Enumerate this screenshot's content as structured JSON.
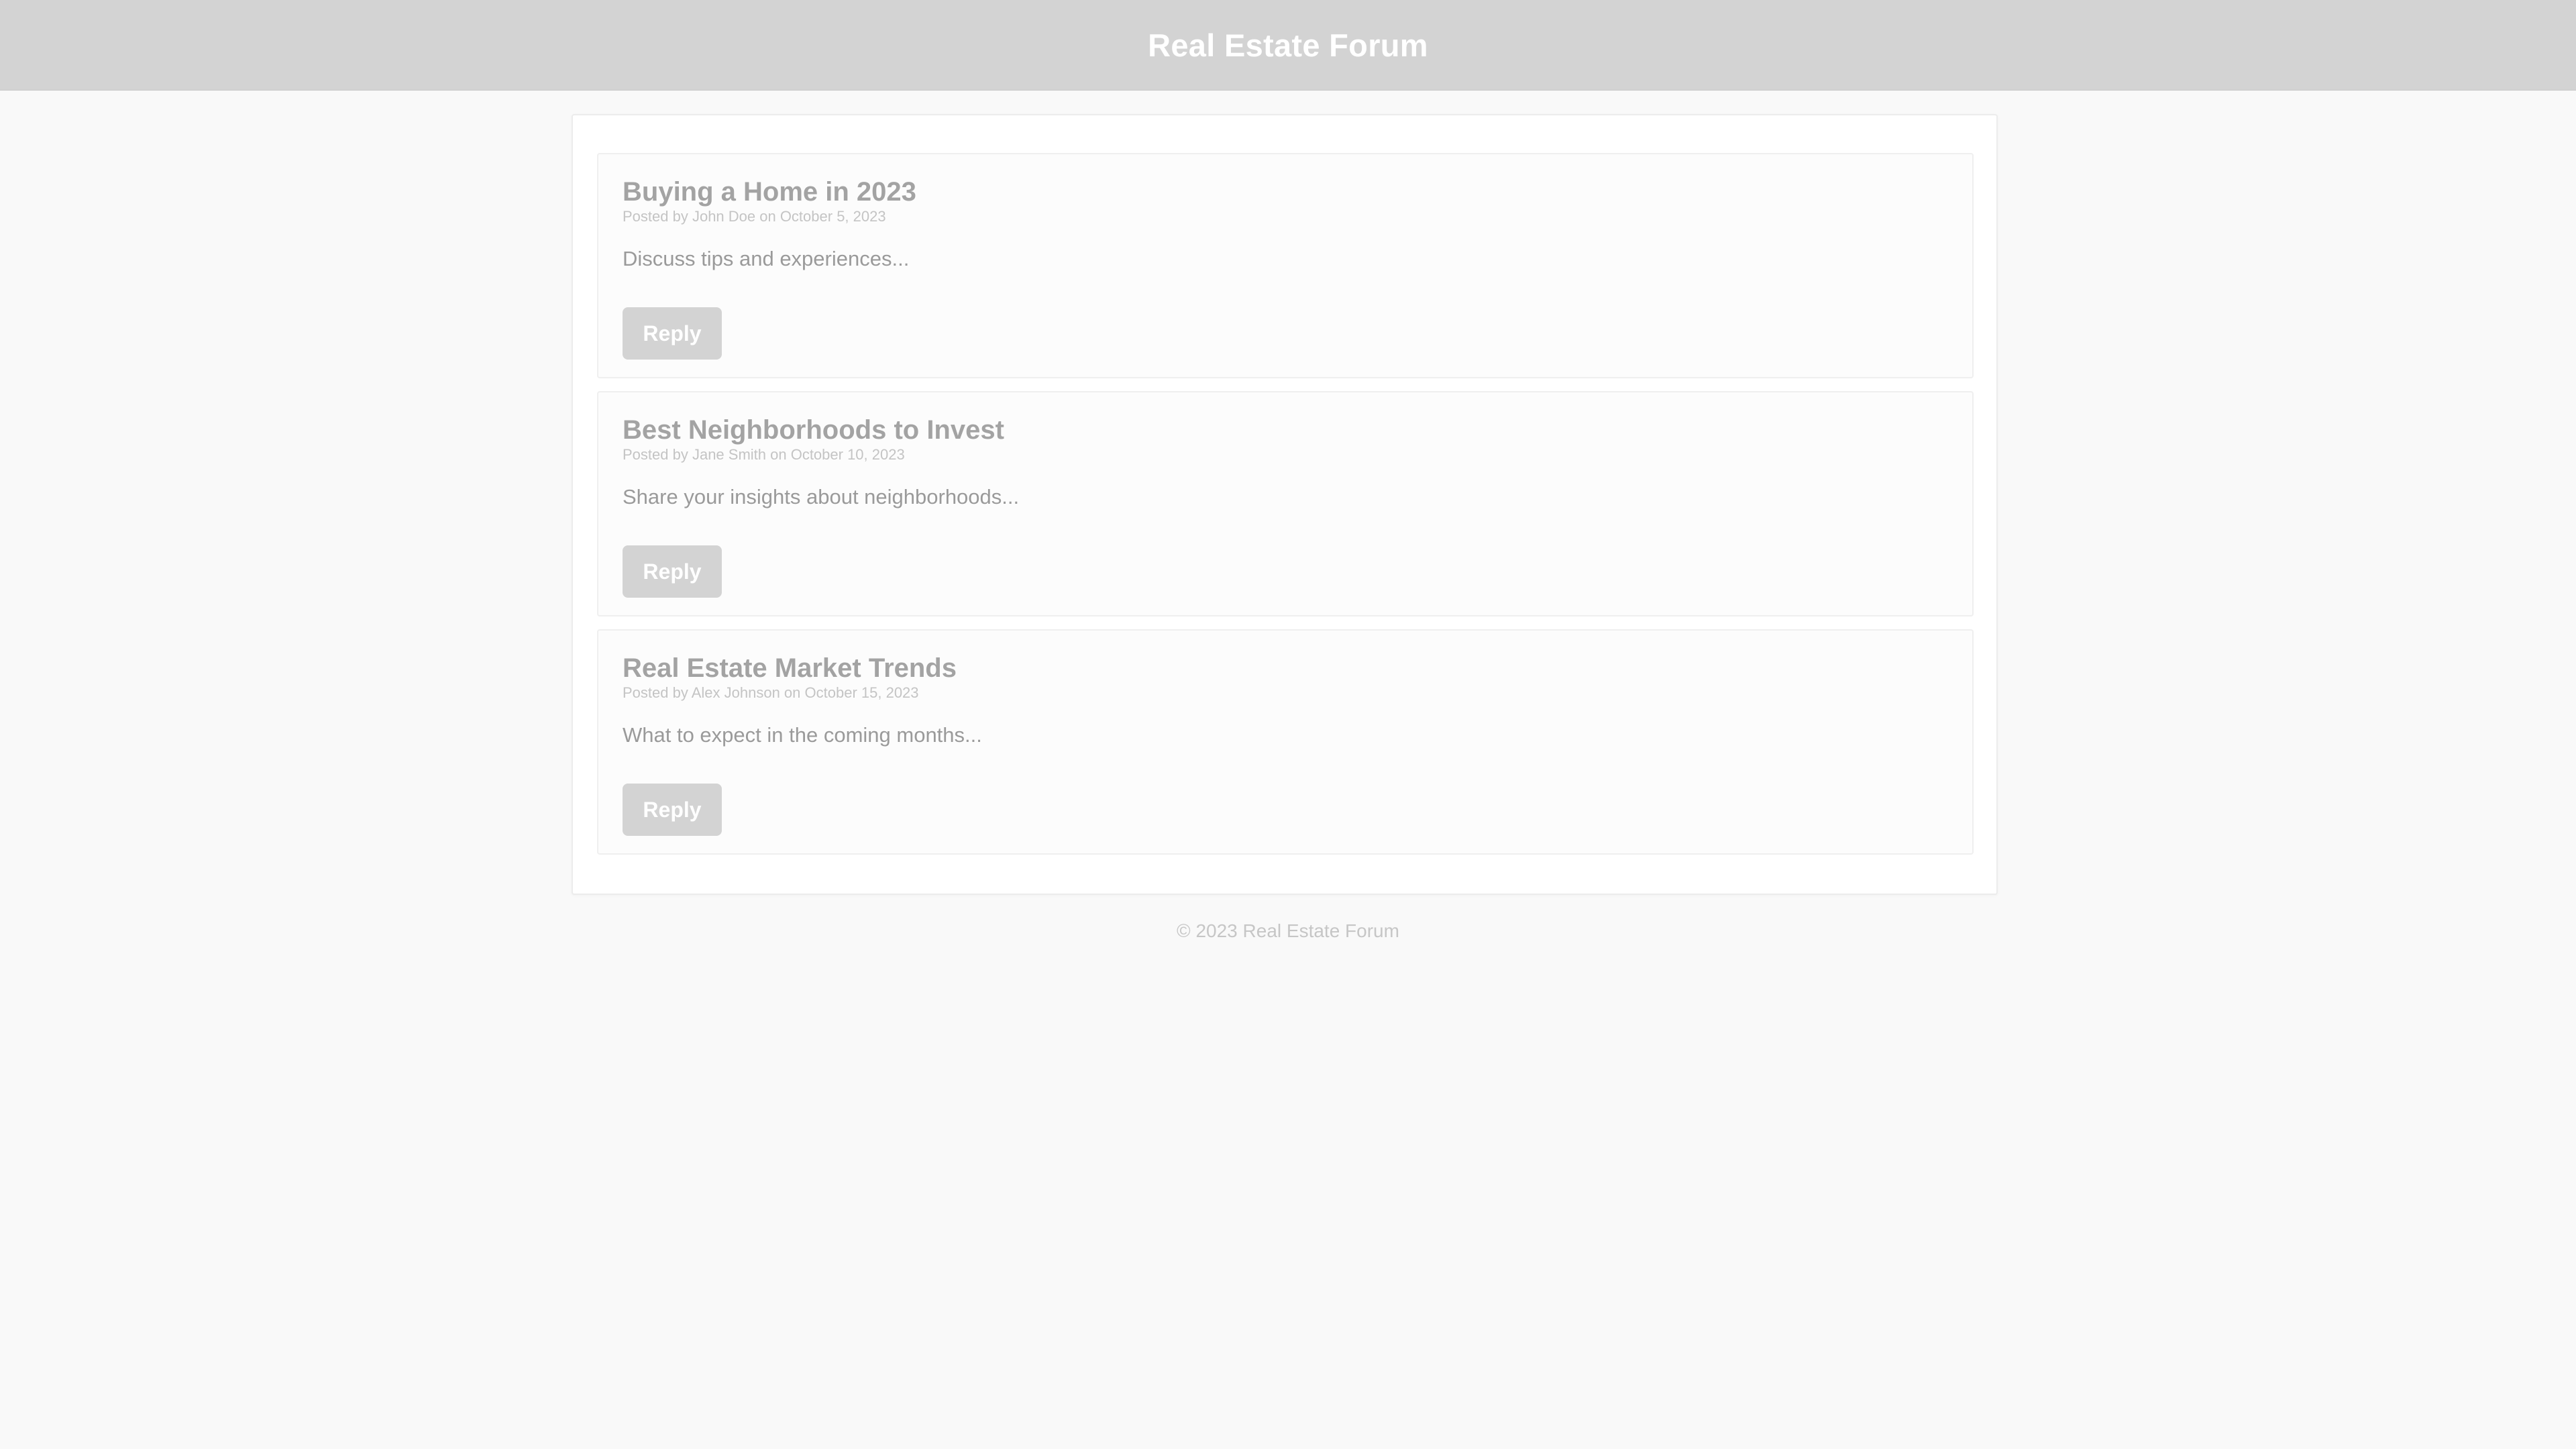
{
  "header": {
    "title": "Real Estate Forum"
  },
  "posts": [
    {
      "title": "Buying a Home in 2023",
      "meta": "Posted by John Doe on October 5, 2023",
      "body": "Discuss tips and experiences...",
      "reply_label": "Reply"
    },
    {
      "title": "Best Neighborhoods to Invest",
      "meta": "Posted by Jane Smith on October 10, 2023",
      "body": "Share your insights about neighborhoods...",
      "reply_label": "Reply"
    },
    {
      "title": "Real Estate Market Trends",
      "meta": "Posted by Alex Johnson on October 15, 2023",
      "body": "What to expect in the coming months...",
      "reply_label": "Reply"
    }
  ],
  "footer": {
    "text": "© 2023 Real Estate Forum"
  },
  "colors": {
    "header_bg": "#d3d3d3",
    "page_bg": "#f9f9f9",
    "button_bg": "#d3d3d3",
    "title_text": "#a3a3a3"
  }
}
